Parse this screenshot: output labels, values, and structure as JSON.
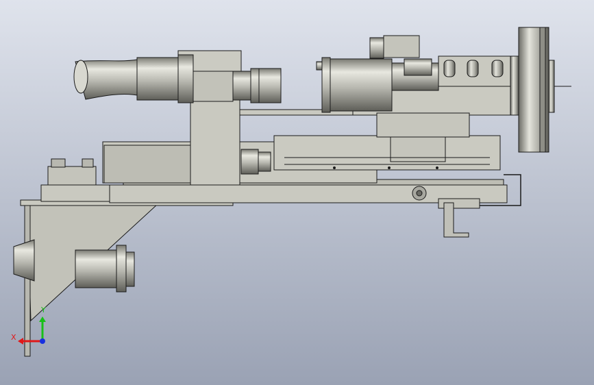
{
  "viewport": {
    "background_top": "#dfe3ec",
    "background_bottom": "#9aa2b4"
  },
  "model": {
    "part_fill": "#c9c9c0",
    "part_shade": "#9e9e96",
    "edge_color": "#1a1a1a",
    "cylinder_light": "#e6e6df",
    "cylinder_dark": "#6f6f68"
  },
  "triad": {
    "x_label": "X",
    "y_label": "Y",
    "x_color": "#e01818",
    "y_color": "#18c018",
    "z_color": "#1830e0"
  }
}
